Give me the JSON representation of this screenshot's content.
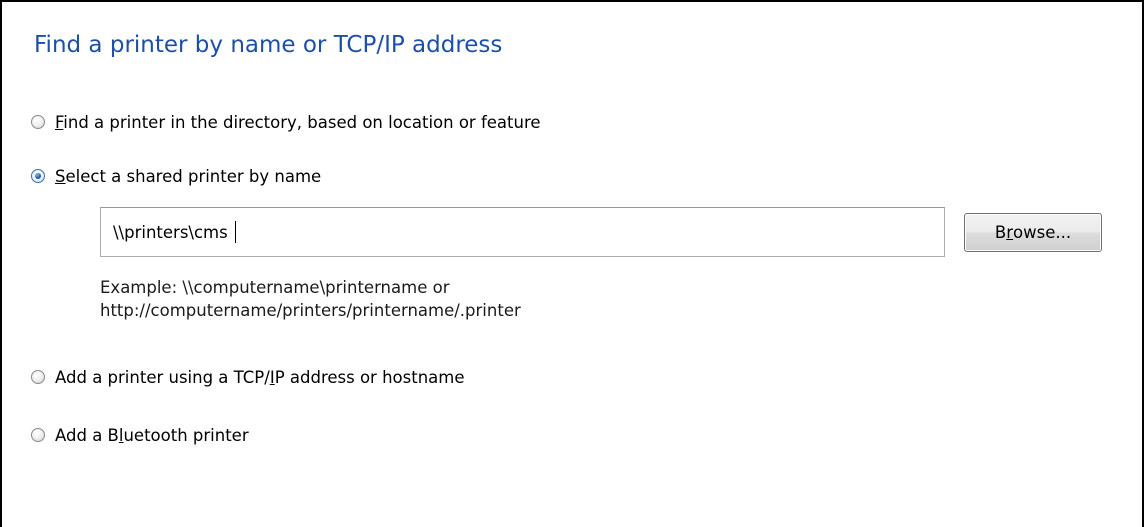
{
  "dialog": {
    "title": "Find a printer by name or TCP/IP address"
  },
  "options": [
    {
      "label_pre": "",
      "mnemonic": "F",
      "label_post": "ind a printer in the directory, based on location or feature",
      "selected": false
    },
    {
      "label_pre": "",
      "mnemonic": "S",
      "label_post": "elect a shared printer by name",
      "selected": true
    },
    {
      "label_pre": "Add a printer using a TCP/",
      "mnemonic": "I",
      "label_post": "P address or hostname",
      "selected": false
    },
    {
      "label_pre": "Add a B",
      "mnemonic": "l",
      "label_post": "uetooth printer",
      "selected": false
    }
  ],
  "shared_printer": {
    "input_value": "\\\\printers\\cms ",
    "browse_pre": "B",
    "browse_mnemonic": "r",
    "browse_post": "owse...",
    "example_line1": "Example: \\\\computername\\printername or",
    "example_line2": "http://computername/printers/printername/.printer"
  },
  "colors": {
    "title": "#1e4fa8",
    "frame_border": "#000000",
    "radio_selected": "#1d5fb0"
  }
}
